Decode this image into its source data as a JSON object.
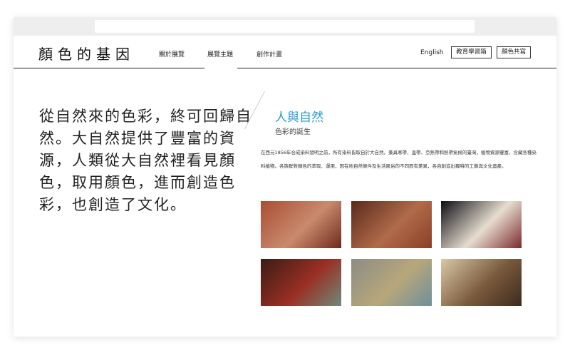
{
  "header": {
    "logo": "顏色的基因",
    "nav": [
      "關於展覽",
      "展覽主題",
      "創作計畫"
    ],
    "lang": "English",
    "buttons": [
      "教育學習箱",
      "顏色共寫"
    ]
  },
  "intro": "從自然來的色彩，終可回歸自然。大自然提供了豐富的資源，人類從大自然裡看見顏色，取用顏色，進而創造色彩，也創造了文化。",
  "section": {
    "title": "人與自然",
    "subtitle": "色彩的誕生",
    "body": "在西元1856年合成染料發明之前，所有染料皆取自於大自然。兼具寒帶、溫帶、亞熱帶和熱帶氣候的臺灣，植物資源豐富，含藏各種染料植物。各族群對顏色的萃取、運用，因在地自然條件及生活風俗的不同而有差異，各自創造出獨特的工藝與文化遺產。"
  },
  "gallery": [
    {
      "name": "cave-painting-photo",
      "colors": [
        "#a94e34",
        "#c98a6c",
        "#6d2a1d"
      ]
    },
    {
      "name": "clay-pottery-photo",
      "colors": [
        "#5a2a1c",
        "#b06b4a",
        "#8a3f27"
      ]
    },
    {
      "name": "woven-textile-photo",
      "colors": [
        "#0d0d12",
        "#e6ddd0",
        "#7a2a2a"
      ]
    },
    {
      "name": "temple-window-photo",
      "colors": [
        "#3a1c14",
        "#9a2f24",
        "#6e8a7a"
      ]
    },
    {
      "name": "dyed-yarn-photo",
      "colors": [
        "#8c8c86",
        "#b7a77a",
        "#6f8f9c"
      ]
    },
    {
      "name": "indigenous-people-photo",
      "colors": [
        "#d8c9a8",
        "#7a5a3c",
        "#3c2a1e"
      ]
    }
  ]
}
